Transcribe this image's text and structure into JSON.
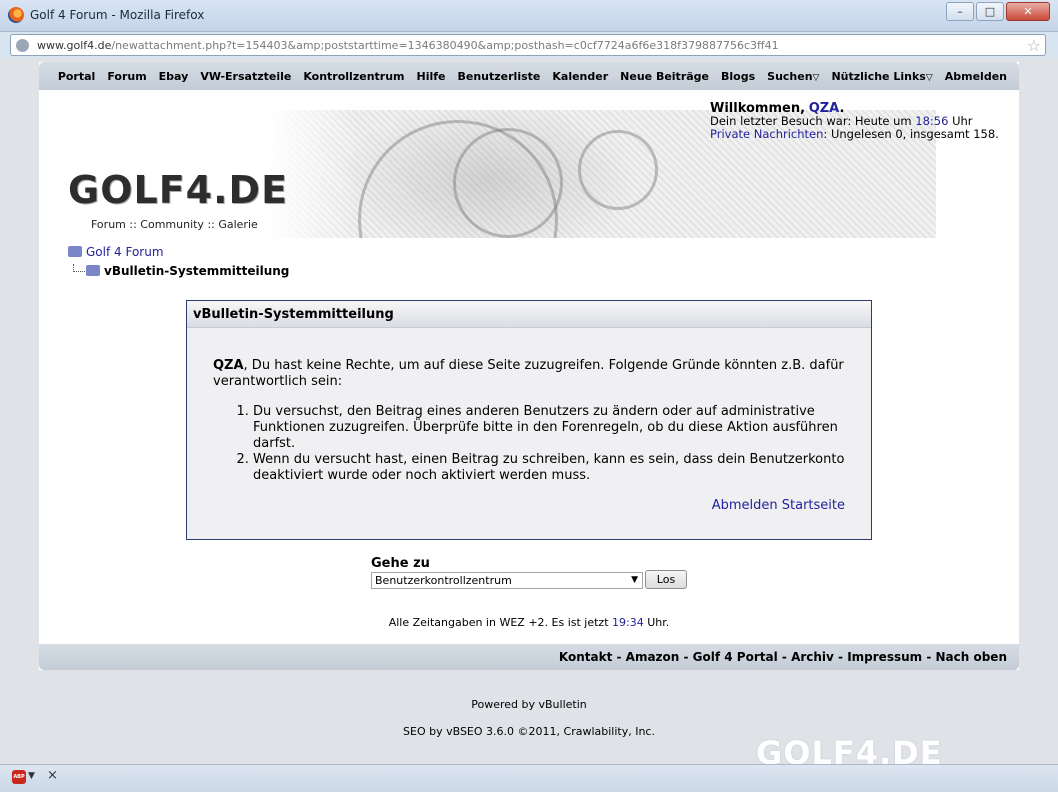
{
  "window": {
    "title": "Golf 4 Forum - Mozilla Firefox",
    "minimize": "–",
    "maximize": "□",
    "close": "✕"
  },
  "urlbar": {
    "url_domain": "www.golf4.de",
    "url_rest": "/newattachment.php?t=154403&amp;poststarttime=1346380490&amp;posthash=c0cf7724a6f6e318f379887756c3ff41"
  },
  "nav": {
    "items": [
      "Portal",
      "Forum",
      "Ebay",
      "VW-Ersatzteile",
      "Kontrollzentrum",
      "Hilfe",
      "Benutzerliste",
      "Kalender",
      "Neue Beiträge",
      "Blogs"
    ],
    "dropdowns": [
      "Suchen",
      "Nützliche Links"
    ],
    "logout": "Abmelden"
  },
  "welcome": {
    "greeting": "Willkommen,",
    "username": "QZA",
    "last_visit_prefix": "Dein letzter Besuch war: Heute um",
    "last_visit_time": "18:56",
    "last_visit_suffix": "Uhr",
    "pm_label": "Private Nachrichten",
    "pm_stats": ": Ungelesen 0, insgesamt 158."
  },
  "banner": {
    "logo": "GOLF4.DE",
    "tagline": "Forum :: Community :: Galerie"
  },
  "breadcrumb": {
    "root": "Golf 4 Forum",
    "current": "vBulletin-Systemmitteilung"
  },
  "message": {
    "title": "vBulletin-Systemmitteilung",
    "user": "QZA",
    "intro": ", Du hast keine Rechte, um auf diese Seite zuzugreifen. Folgende Gründe könnten z.B. dafür verantwortlich sein:",
    "reasons": [
      "Du versuchst, den Beitrag eines anderen Benutzers zu ändern oder auf administrative Funktionen zuzugreifen. Überprüfe bitte in den Forenregeln, ob du diese Aktion ausführen darfst.",
      "Wenn du versucht hast, einen Beitrag zu schreiben, kann es sein, dass dein Benutzerkonto deaktiviert wurde oder noch aktiviert werden muss."
    ],
    "link_logout": "Abmelden",
    "link_home": "Startseite"
  },
  "goto": {
    "label": "Gehe zu",
    "selected": "Benutzerkontrollzentrum",
    "button": "Los"
  },
  "timezone": {
    "prefix": "Alle Zeitangaben in WEZ +2. Es ist jetzt",
    "time": "19:34",
    "suffix": "Uhr."
  },
  "footer": {
    "links": [
      "Kontakt",
      "Amazon",
      "Golf 4 Portal",
      "Archiv",
      "Impressum",
      "Nach oben"
    ],
    "powered": "Powered by vBulletin",
    "seo": "SEO by vBSEO 3.6.0 ©2011, Crawlability, Inc.",
    "logo": "GOLF4.DE"
  },
  "statusbar": {
    "abp": "ABP",
    "close": "×"
  }
}
